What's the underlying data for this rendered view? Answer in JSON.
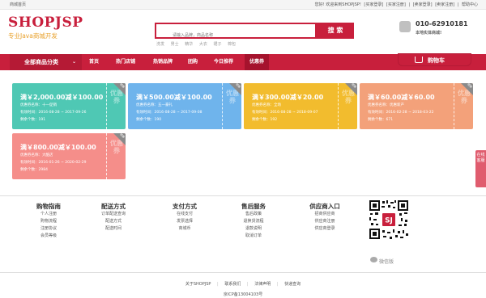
{
  "topbar": {
    "home": "商城首页",
    "welcome": "您好! 欢迎来到SHOPJSP!",
    "buyer_login": "[买家登录]",
    "buyer_register": "[买家注册]",
    "seller_login": "[卖家登录]",
    "seller_register": "[卖家注册]",
    "sep": "|",
    "help": "帮助中心"
  },
  "logo": {
    "name": "SHOPJSP",
    "tagline": "专业Java商城开发"
  },
  "search": {
    "placeholder": "请输入品牌，商品名称",
    "button": "搜 索",
    "hot_keywords": [
      "洗发",
      "男士",
      "精华",
      "大衣",
      "裙子",
      "棉包"
    ]
  },
  "phone": {
    "number": "010-62910181",
    "subtitle": "本地实体商城!"
  },
  "nav": {
    "all_categories": "全部商品分类",
    "chevron": "⌄",
    "items": [
      "首页",
      "热门店铺",
      "热销品牌",
      "团购",
      "今日推荐",
      "优惠券"
    ]
  },
  "cart": {
    "label": "购物车"
  },
  "coupons": [
    {
      "amount": "满￥2,000.00减￥100.00",
      "name": "优惠券名称：十一促销",
      "validity": "有效时间：2016-08-28 ~ 2017-09-26",
      "remaining": "剩余个数：191",
      "color": "#4fc8b4",
      "stub": "优惠券",
      "corner": "领券"
    },
    {
      "amount": "满￥500.00减￥100.00",
      "name": "优惠券名称：五一豪礼",
      "validity": "有效时间：2016-08-28 ~ 2017-09-08",
      "remaining": "剩余个数：190",
      "color": "#6fb4ec",
      "stub": "优惠券",
      "corner": "领券"
    },
    {
      "amount": "满￥300.00减￥20.00",
      "name": "优惠券名称：全场",
      "validity": "有效时间：2016-08-28 ~ 2018-09-07",
      "remaining": "剩余个数：192",
      "color": "#f2bc2e",
      "stub": "优惠券",
      "corner": "领券"
    },
    {
      "amount": "满￥60.00减￥60.00",
      "name": "优惠券名称：优惠新产",
      "validity": "有效时间：2016-02-28 ~ 2018-03-22",
      "remaining": "剩余个数：671",
      "color": "#f3a17a",
      "stub": "优惠券",
      "corner": "领券"
    },
    {
      "amount": "满￥800.00减￥100.00",
      "name": "优惠券名称：大酷店",
      "validity": "有效时间：2016-01-26 ~ 2020-02-29",
      "remaining": "剩余个数：2984",
      "color": "#f58e8a",
      "stub": "优惠券",
      "corner": "领券"
    }
  ],
  "side_tab": {
    "label": "在线客服"
  },
  "footer": {
    "columns": [
      {
        "title": "购物指南",
        "links": [
          "个人注册",
          "购物流程",
          "注册协议",
          "会员等级"
        ]
      },
      {
        "title": "配送方式",
        "links": [
          "订单配送查询",
          "配送方式",
          "配送时间"
        ]
      },
      {
        "title": "支付方式",
        "links": [
          "在线支付",
          "发票选择",
          "商城币"
        ]
      },
      {
        "title": "售后服务",
        "links": [
          "售后政策",
          "退换货流程",
          "退款说明",
          "取消订单"
        ]
      },
      {
        "title": "供应商入口",
        "links": [
          "招商供应商",
          "供应商注册",
          "供应商登录"
        ]
      }
    ],
    "qr_label": "微信版",
    "qr_mark": "SJ",
    "links": [
      "关于SHOPJSP",
      "联系我们",
      "法律声明",
      "快递查询"
    ],
    "link_sep": "|",
    "icp": "京ICP备13004103号"
  }
}
